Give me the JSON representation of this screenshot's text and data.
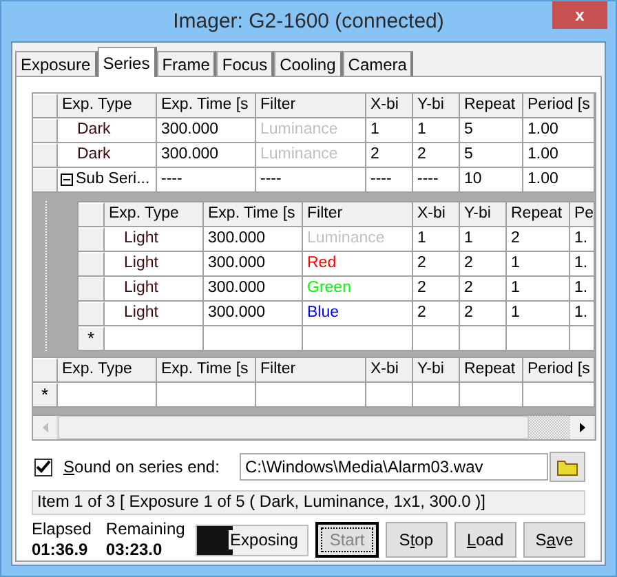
{
  "window": {
    "title": "Imager: G2-1600 (connected)",
    "close_label": "x"
  },
  "tabs": [
    {
      "label": "Exposure",
      "selected": false
    },
    {
      "label": "Series",
      "selected": true
    },
    {
      "label": "Frame",
      "selected": false
    },
    {
      "label": "Focus",
      "selected": false
    },
    {
      "label": "Cooling",
      "selected": false
    },
    {
      "label": "Camera",
      "selected": false
    }
  ],
  "series_grid": {
    "columns": [
      "Exp. Type",
      "Exp. Time [s",
      "Filter",
      "X-bi",
      "Y-bi",
      "Repeat",
      "Period [s"
    ],
    "rows": [
      {
        "kind": "exposure",
        "exp_type": "Dark",
        "exp_time": "300.000",
        "filter": "Luminance",
        "color": "#c0c0c0",
        "x_bin": "1",
        "y_bin": "1",
        "repeat": "5",
        "period": "1.00"
      },
      {
        "kind": "exposure",
        "exp_type": "Dark",
        "exp_time": "300.000",
        "filter": "Luminance",
        "color": "#c0c0c0",
        "x_bin": "2",
        "y_bin": "2",
        "repeat": "5",
        "period": "1.00"
      },
      {
        "kind": "sub_series",
        "expanded": true,
        "exp_type": "Sub Seri...",
        "exp_time": "----",
        "filter": "----",
        "x_bin": "----",
        "y_bin": "----",
        "repeat": "10",
        "period": "1.00",
        "sub_grid": {
          "columns": [
            "Exp. Type",
            "Exp. Time [s",
            "Filter",
            "X-bi",
            "Y-bi",
            "Repeat",
            "Pe"
          ],
          "rows": [
            {
              "exp_type": "Light",
              "exp_time": "300.000",
              "filter": "Luminance",
              "color": "#c0c0c0",
              "x_bin": "1",
              "y_bin": "1",
              "repeat": "2",
              "period": "1."
            },
            {
              "exp_type": "Light",
              "exp_time": "300.000",
              "filter": "Red",
              "color": "#ff0000",
              "x_bin": "2",
              "y_bin": "2",
              "repeat": "1",
              "period": "1."
            },
            {
              "exp_type": "Light",
              "exp_time": "300.000",
              "filter": "Green",
              "color": "#00ff00",
              "x_bin": "2",
              "y_bin": "2",
              "repeat": "1",
              "period": "1."
            },
            {
              "exp_type": "Light",
              "exp_time": "300.000",
              "filter": "Blue",
              "color": "#0000ff",
              "x_bin": "2",
              "y_bin": "2",
              "repeat": "1",
              "period": "1."
            }
          ],
          "new_row_marker": "*"
        }
      }
    ]
  },
  "new_grid": {
    "columns": [
      "Exp. Type",
      "Exp. Time [s",
      "Filter",
      "X-bi",
      "Y-bi",
      "Repeat",
      "Period [s"
    ],
    "new_row_marker": "*"
  },
  "sound": {
    "checked": true,
    "label_parts": [
      "S",
      "ound on series end:"
    ],
    "path": "C:\\Windows\\Media\\Alarm03.wav"
  },
  "status": "Item 1 of 3 [ Exposure 1 of 5 ( Dark, Luminance, 1x1, 300.0 )]",
  "elapsed": {
    "label": "Elapsed",
    "value": "01:36.9"
  },
  "remaining": {
    "label": "Remaining",
    "value": "03:23.0"
  },
  "progress": {
    "label": "Exposing",
    "level": 0.33
  },
  "buttons": [
    {
      "label_parts": [
        "Start"
      ],
      "disabled": true,
      "focused": true
    },
    {
      "label_parts": [
        "S",
        "t",
        "op"
      ],
      "disabled": false,
      "focused": false
    },
    {
      "label_parts": [
        "L",
        "oad"
      ],
      "disabled": false,
      "focused": false
    },
    {
      "label_parts": [
        "S",
        "a",
        "ve"
      ],
      "disabled": false,
      "focused": false
    }
  ]
}
